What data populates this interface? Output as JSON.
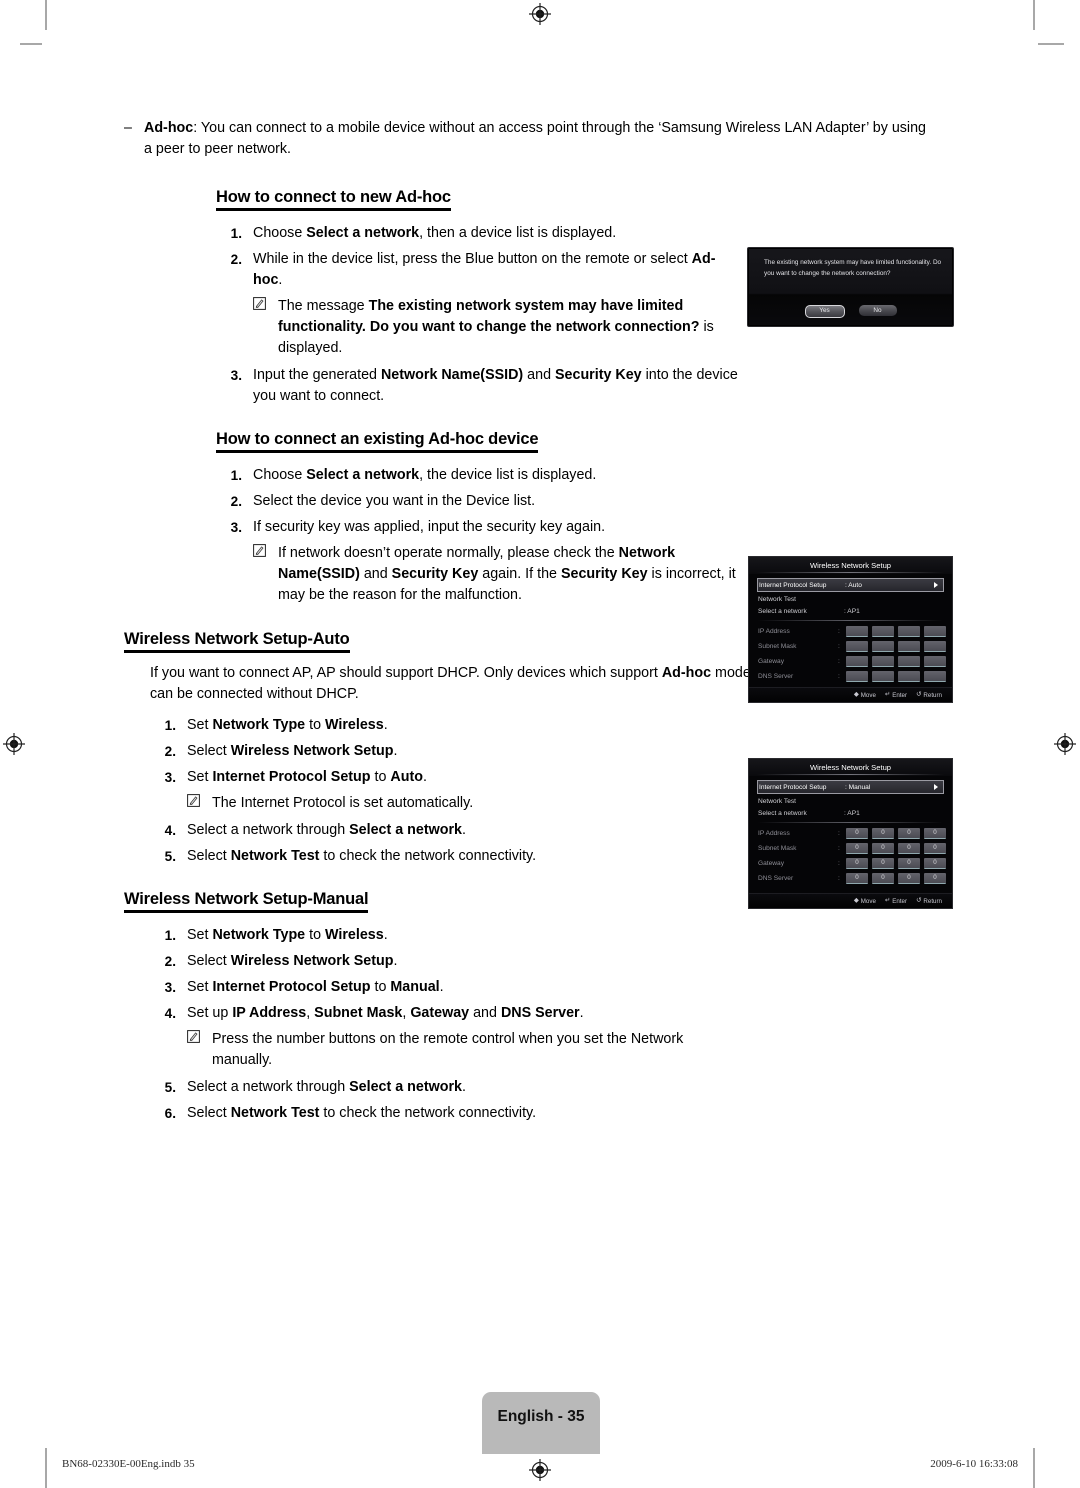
{
  "page": {
    "footer_label": "English - 35",
    "footer_file": "BN68-02330E-00Eng.indb   35",
    "footer_timestamp": "2009-6-10   16:33:08"
  },
  "intro": {
    "dash": "–",
    "term": "Ad-hoc",
    "text_after_term": ": You can connect to a mobile device without an access point through the ‘Samsung Wireless LAN Adapter’ by using a peer to peer network."
  },
  "sections": [
    {
      "id": "new-adhoc",
      "heading": "How to connect to new Ad-hoc",
      "steps": [
        {
          "num": "1.",
          "parts": [
            {
              "t": "Choose ",
              "b": false
            },
            {
              "t": "Select a network",
              "b": true
            },
            {
              "t": ", then a device list is displayed.",
              "b": false
            }
          ]
        },
        {
          "num": "2.",
          "parts": [
            {
              "t": "While in the device list, press the Blue button on the remote or select ",
              "b": false
            },
            {
              "t": "Ad-hoc",
              "b": true
            },
            {
              "t": ".",
              "b": false
            }
          ]
        },
        {
          "num": "3.",
          "parts": [
            {
              "t": "Input the generated ",
              "b": false
            },
            {
              "t": "Network Name(SSID)",
              "b": true
            },
            {
              "t": " and ",
              "b": false
            },
            {
              "t": "Security Key",
              "b": true
            },
            {
              "t": " into the device you want to connect.",
              "b": false
            }
          ]
        }
      ],
      "note_after_step": 2,
      "note": {
        "parts": [
          {
            "t": "The message ",
            "b": false
          },
          {
            "t": "The existing network system may have limited functionality. Do you want to change the network connection?",
            "b": true
          },
          {
            "t": " is displayed.",
            "b": false
          }
        ]
      }
    },
    {
      "id": "existing-adhoc",
      "heading": "How to connect an existing Ad-hoc device",
      "steps": [
        {
          "num": "1.",
          "parts": [
            {
              "t": "Choose ",
              "b": false
            },
            {
              "t": "Select a network",
              "b": true
            },
            {
              "t": ", the device list is displayed.",
              "b": false
            }
          ]
        },
        {
          "num": "2.",
          "parts": [
            {
              "t": "Select the device you want in the Device list.",
              "b": false
            }
          ]
        },
        {
          "num": "3.",
          "parts": [
            {
              "t": "If security key was applied, input the security key again.",
              "b": false
            }
          ]
        }
      ],
      "note_after_step": 3,
      "note": {
        "parts": [
          {
            "t": "If network doesn’t operate normally, please check the ",
            "b": false
          },
          {
            "t": "Network Name(SSID)",
            "b": true
          },
          {
            "t": " and ",
            "b": false
          },
          {
            "t": "Security Key",
            "b": true
          },
          {
            "t": " again. If the ",
            "b": false
          },
          {
            "t": "Security Key",
            "b": true
          },
          {
            "t": " is incorrect, it may be the reason for the malfunction.",
            "b": false
          }
        ]
      }
    },
    {
      "id": "setup-auto",
      "heading": "Wireless Network Setup-Auto",
      "paragraph": [
        {
          "t": "If you want to connect AP, AP should support DHCP. Only devices which support ",
          "b": false
        },
        {
          "t": "Ad-hoc",
          "b": true
        },
        {
          "t": " mode can be connected without DHCP.",
          "b": false
        }
      ],
      "steps": [
        {
          "num": "1.",
          "parts": [
            {
              "t": "Set ",
              "b": false
            },
            {
              "t": "Network Type",
              "b": true
            },
            {
              "t": " to ",
              "b": false
            },
            {
              "t": "Wireless",
              "b": true
            },
            {
              "t": ".",
              "b": false
            }
          ]
        },
        {
          "num": "2.",
          "parts": [
            {
              "t": "Select ",
              "b": false
            },
            {
              "t": "Wireless Network Setup",
              "b": true
            },
            {
              "t": ".",
              "b": false
            }
          ]
        },
        {
          "num": "3.",
          "parts": [
            {
              "t": "Set ",
              "b": false
            },
            {
              "t": "Internet Protocol Setup",
              "b": true
            },
            {
              "t": " to ",
              "b": false
            },
            {
              "t": "Auto",
              "b": true
            },
            {
              "t": ".",
              "b": false
            }
          ]
        },
        {
          "num": "4.",
          "parts": [
            {
              "t": "Select a network through ",
              "b": false
            },
            {
              "t": "Select a network",
              "b": true
            },
            {
              "t": ".",
              "b": false
            }
          ]
        },
        {
          "num": "5.",
          "parts": [
            {
              "t": "Select ",
              "b": false
            },
            {
              "t": "Network Test",
              "b": true
            },
            {
              "t": " to check the network connectivity.",
              "b": false
            }
          ]
        }
      ],
      "note_after_step": 3,
      "note": {
        "parts": [
          {
            "t": "The Internet Protocol is set automatically.",
            "b": false
          }
        ]
      }
    },
    {
      "id": "setup-manual",
      "heading": "Wireless Network Setup-Manual",
      "steps": [
        {
          "num": "1.",
          "parts": [
            {
              "t": "Set ",
              "b": false
            },
            {
              "t": "Network Type",
              "b": true
            },
            {
              "t": " to ",
              "b": false
            },
            {
              "t": "Wireless",
              "b": true
            },
            {
              "t": ".",
              "b": false
            }
          ]
        },
        {
          "num": "2.",
          "parts": [
            {
              "t": "Select ",
              "b": false
            },
            {
              "t": "Wireless Network Setup",
              "b": true
            },
            {
              "t": ".",
              "b": false
            }
          ]
        },
        {
          "num": "3.",
          "parts": [
            {
              "t": "Set ",
              "b": false
            },
            {
              "t": "Internet Protocol Setup",
              "b": true
            },
            {
              "t": " to ",
              "b": false
            },
            {
              "t": "Manual",
              "b": true
            },
            {
              "t": ".",
              "b": false
            }
          ]
        },
        {
          "num": "4.",
          "parts": [
            {
              "t": "Set up ",
              "b": false
            },
            {
              "t": "IP Address",
              "b": true
            },
            {
              "t": ", ",
              "b": false
            },
            {
              "t": "Subnet Mask",
              "b": true
            },
            {
              "t": ", ",
              "b": false
            },
            {
              "t": "Gateway",
              "b": true
            },
            {
              "t": " and ",
              "b": false
            },
            {
              "t": "DNS Server",
              "b": true
            },
            {
              "t": ".",
              "b": false
            }
          ]
        },
        {
          "num": "5.",
          "parts": [
            {
              "t": "Select a network through ",
              "b": false
            },
            {
              "t": "Select a network",
              "b": true
            },
            {
              "t": ".",
              "b": false
            }
          ]
        },
        {
          "num": "6.",
          "parts": [
            {
              "t": "Select ",
              "b": false
            },
            {
              "t": "Network Test",
              "b": true
            },
            {
              "t": " to check the network connectivity.",
              "b": false
            }
          ]
        }
      ],
      "note_after_step": 4,
      "note": {
        "parts": [
          {
            "t": "Press the number buttons on the remote control when you set the Network manually.",
            "b": false
          }
        ]
      }
    }
  ],
  "osd_dialog": {
    "message": "The existing network system may have limited functionality. Do you want to change the network connection?",
    "yes_label": "Yes",
    "no_label": "No"
  },
  "osd_auto": {
    "title": "Wireless Network Setup",
    "rows": [
      {
        "label": "Internet Protocol Setup",
        "value": ": Auto",
        "highlighted": true
      },
      {
        "label": "Network Test",
        "value": "",
        "highlighted": false
      },
      {
        "label": "Select a network",
        "value": ": AP1",
        "highlighted": false
      }
    ],
    "ip_rows": [
      {
        "label": "IP Address",
        "boxes": [
          "",
          "",
          "",
          ""
        ]
      },
      {
        "label": "Subnet Mask",
        "boxes": [
          "",
          "",
          "",
          ""
        ]
      },
      {
        "label": "Gateway",
        "boxes": [
          "",
          "",
          "",
          ""
        ]
      },
      {
        "label": "DNS Server",
        "boxes": [
          "",
          "",
          "",
          ""
        ]
      }
    ],
    "nav": [
      {
        "glyph": "◆",
        "label": "Move"
      },
      {
        "glyph": "↵",
        "label": "Enter"
      },
      {
        "glyph": "↺",
        "label": "Return"
      }
    ]
  },
  "osd_manual": {
    "title": "Wireless Network Setup",
    "rows": [
      {
        "label": "Internet Protocol Setup",
        "value": ": Manual",
        "highlighted": true
      },
      {
        "label": "Network Test",
        "value": "",
        "highlighted": false
      },
      {
        "label": "Select a network",
        "value": ": AP1",
        "highlighted": false
      }
    ],
    "ip_rows": [
      {
        "label": "IP Address",
        "boxes": [
          "0",
          "0",
          "0",
          "0"
        ]
      },
      {
        "label": "Subnet Mask",
        "boxes": [
          "0",
          "0",
          "0",
          "0"
        ]
      },
      {
        "label": "Gateway",
        "boxes": [
          "0",
          "0",
          "0",
          "0"
        ]
      },
      {
        "label": "DNS Server",
        "boxes": [
          "0",
          "0",
          "0",
          "0"
        ]
      }
    ],
    "nav": [
      {
        "glyph": "◆",
        "label": "Move"
      },
      {
        "glyph": "↵",
        "label": "Enter"
      },
      {
        "glyph": "↺",
        "label": "Return"
      }
    ]
  }
}
